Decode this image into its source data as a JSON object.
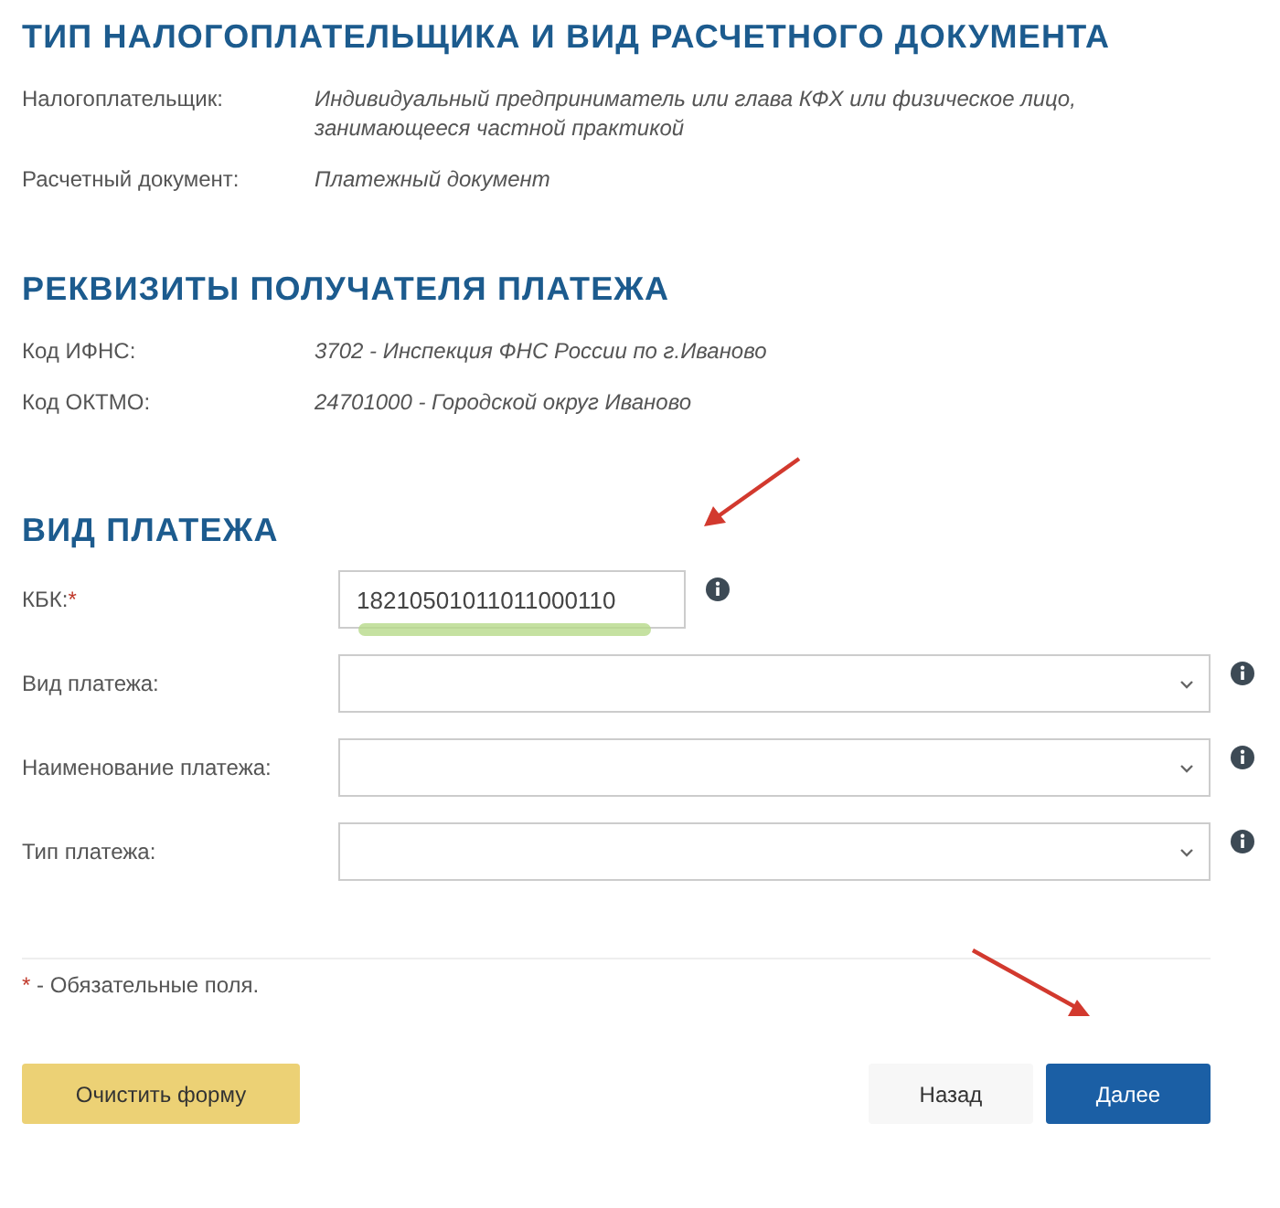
{
  "info_sections": [
    {
      "title": "ТИП НАЛОГОПЛАТЕЛЬЩИКА И ВИД РАСЧЕТНОГО ДОКУМЕНТА",
      "rows": [
        {
          "label": "Налогоплательщик:",
          "value": "Индивидуальный предприниматель или глава КФХ или физическое лицо, занимающееся частной практикой"
        },
        {
          "label": "Расчетный документ:",
          "value": "Платежный документ"
        }
      ]
    },
    {
      "title": "РЕКВИЗИТЫ ПОЛУЧАТЕЛЯ ПЛАТЕЖА",
      "rows": [
        {
          "label": "Код ИФНС:",
          "value": "3702 - Инспекция ФНС России по г.Иваново"
        },
        {
          "label": "Код ОКТМО:",
          "value": "24701000 - Городской округ Иваново"
        }
      ]
    }
  ],
  "payment_section": {
    "title": "ВИД ПЛАТЕЖА",
    "fields": [
      {
        "kind": "text",
        "label": "КБК:",
        "required_mark": "*",
        "value": "18210501011011000110",
        "highlighted": true
      },
      {
        "kind": "select",
        "label": "Вид платежа:"
      },
      {
        "kind": "select",
        "label": "Наименование платежа:"
      },
      {
        "kind": "select",
        "label": "Тип платежа:"
      }
    ]
  },
  "required_note": {
    "mark": "*",
    "text": "- Обязательные поля."
  },
  "buttons": [
    {
      "kind": "warning",
      "label": "Очистить форму"
    },
    {
      "kind": "plain",
      "label": "Назад"
    },
    {
      "kind": "primary",
      "label": "Далее"
    }
  ]
}
